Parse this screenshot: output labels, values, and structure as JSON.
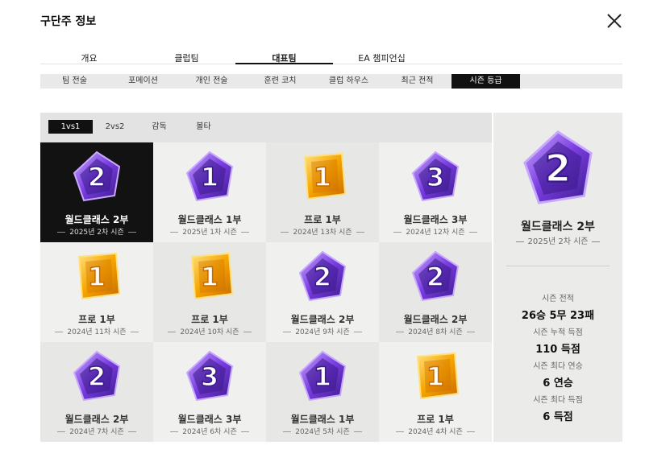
{
  "dialog": {
    "title": "구단주 정보"
  },
  "main_tabs": [
    {
      "label": "개요",
      "active": false
    },
    {
      "label": "클럽팀",
      "active": false
    },
    {
      "label": "대표팀",
      "active": true
    },
    {
      "label": "EA 챔피언십",
      "active": false
    }
  ],
  "sub_tabs": [
    {
      "label": "팀 전술",
      "active": false
    },
    {
      "label": "포메이션",
      "active": false
    },
    {
      "label": "개인 전술",
      "active": false
    },
    {
      "label": "훈련 코치",
      "active": false
    },
    {
      "label": "클럽 하우스",
      "active": false
    },
    {
      "label": "최근 전적",
      "active": false
    },
    {
      "label": "시즌 등급",
      "active": true
    }
  ],
  "mode_tabs": [
    {
      "label": "1vs1",
      "active": true
    },
    {
      "label": "2vs2",
      "active": false
    },
    {
      "label": "감독",
      "active": false
    },
    {
      "label": "볼타",
      "active": false
    }
  ],
  "seasons": [
    {
      "tier": "월드클래스 2부",
      "season": "2025년 2차 시즌",
      "badge": "purple",
      "num": "2",
      "selected": true
    },
    {
      "tier": "월드클래스 1부",
      "season": "2025년 1차 시즌",
      "badge": "purple",
      "num": "1",
      "selected": false
    },
    {
      "tier": "프로 1부",
      "season": "2024년 13차 시즌",
      "badge": "gold",
      "num": "1",
      "selected": false
    },
    {
      "tier": "월드클래스 3부",
      "season": "2024년 12차 시즌",
      "badge": "purple",
      "num": "3",
      "selected": false
    },
    {
      "tier": "프로 1부",
      "season": "2024년 11차 시즌",
      "badge": "gold",
      "num": "1",
      "selected": false
    },
    {
      "tier": "프로 1부",
      "season": "2024년 10차 시즌",
      "badge": "gold",
      "num": "1",
      "selected": false
    },
    {
      "tier": "월드클래스 2부",
      "season": "2024년 9차 시즌",
      "badge": "purple",
      "num": "2",
      "selected": false
    },
    {
      "tier": "월드클래스 2부",
      "season": "2024년 8차 시즌",
      "badge": "purple",
      "num": "2",
      "selected": false
    },
    {
      "tier": "월드클래스 2부",
      "season": "2024년 7차 시즌",
      "badge": "purple",
      "num": "2",
      "selected": false
    },
    {
      "tier": "월드클래스 3부",
      "season": "2024년 6차 시즌",
      "badge": "purple",
      "num": "3",
      "selected": false
    },
    {
      "tier": "월드클래스 1부",
      "season": "2024년 5차 시즌",
      "badge": "purple",
      "num": "1",
      "selected": false
    },
    {
      "tier": "프로 1부",
      "season": "2024년 4차 시즌",
      "badge": "gold",
      "num": "1",
      "selected": false
    }
  ],
  "detail": {
    "tier": "월드클래스 2부",
    "season": "2025년 2차 시즌",
    "badge": "purple",
    "num": "2",
    "stats": [
      {
        "label": "시즌 전적",
        "value": "26승 5무 23패"
      },
      {
        "label": "시즌 누적 득점",
        "value": "110 득점"
      },
      {
        "label": "시즌 최다 연승",
        "value": "6 연승"
      },
      {
        "label": "시즌 최다 득점",
        "value": "6 득점"
      }
    ]
  },
  "colors": {
    "purple_dark": "#3b1a8a",
    "purple_mid": "#7a3de0",
    "purple_light": "#c8a8ff",
    "gold_dark": "#c96a00",
    "gold_mid": "#f5a300",
    "gold_light": "#ffe07a"
  }
}
